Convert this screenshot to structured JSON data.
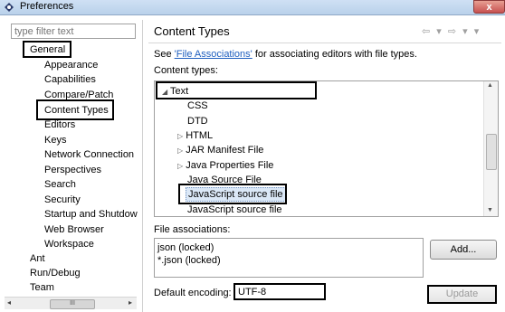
{
  "window": {
    "title": "Preferences",
    "close_label": "x"
  },
  "filter": {
    "placeholder": "type filter text"
  },
  "tree": {
    "general": "General",
    "children": [
      "Appearance",
      "Capabilities",
      "Compare/Patch",
      "Content Types",
      "Editors",
      "Keys",
      "Network Connection",
      "Perspectives",
      "Search",
      "Security",
      "Startup and Shutdow",
      "Web Browser",
      "Workspace"
    ],
    "ant": "Ant",
    "run_debug": "Run/Debug",
    "team": "Team"
  },
  "left_scroll": {
    "left_arrow": "◂",
    "right_arrow": "▸",
    "grip": "III"
  },
  "page": {
    "title": "Content Types",
    "nav": "⇦ ▾ ⇨ ▾ ▾",
    "desc_before": "See ",
    "desc_link": "'File Associations'",
    "desc_after": " for associating editors with file types.",
    "content_types_label": "Content types:",
    "file_associations_label": "File associations:",
    "default_encoding_label": "Default encoding:"
  },
  "content_types": {
    "text": "Text",
    "items": [
      "CSS",
      "DTD",
      "HTML",
      "JAR Manifest File",
      "Java Properties File",
      "Java Source File",
      "JavaScript source file",
      "JavaScript source file"
    ]
  },
  "file_associations": [
    "json (locked)",
    "*.json (locked)"
  ],
  "buttons": {
    "add": "Add...",
    "update": "Update"
  },
  "encoding": {
    "value": "UTF-8"
  },
  "colors": {
    "link": "#1f5fbf",
    "selection_highlight": "#dbe8f7"
  }
}
